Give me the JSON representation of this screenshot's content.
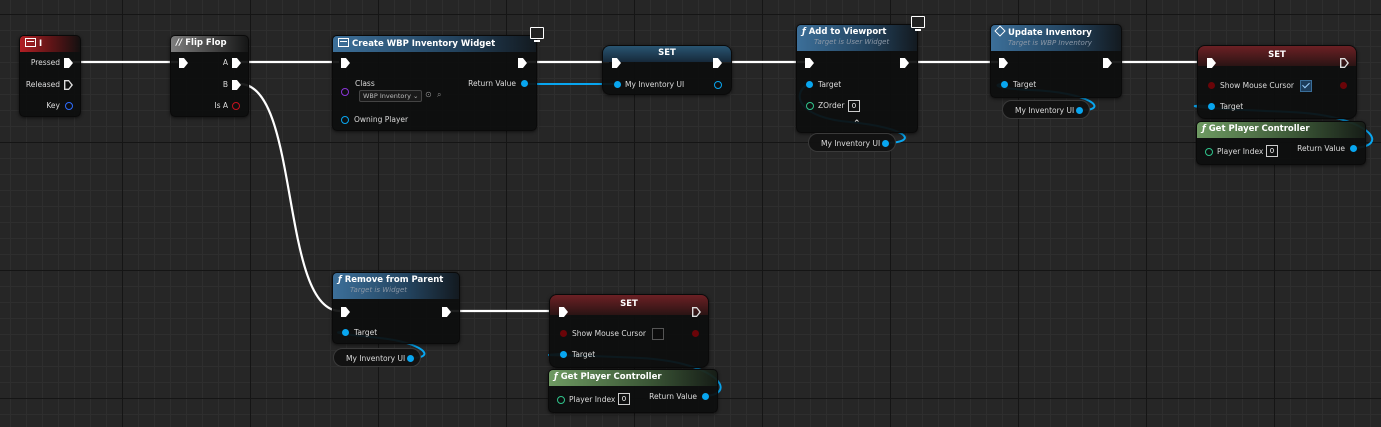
{
  "nodes": {
    "input_i": {
      "title": "I",
      "pressed": "Pressed",
      "released": "Released",
      "key": "Key"
    },
    "flipflop": {
      "title": "Flip Flop",
      "a": "A",
      "b": "B",
      "is_a": "Is A"
    },
    "create_widget": {
      "title": "Create WBP Inventory Widget",
      "class_label": "Class",
      "class_value": "WBP Inventory",
      "owning_player": "Owning Player",
      "return_value": "Return Value"
    },
    "set_inventory": {
      "title": "SET",
      "var": "My Inventory UI"
    },
    "add_viewport": {
      "title": "Add to Viewport",
      "subtitle": "Target is User Widget",
      "target": "Target",
      "zorder": "ZOrder",
      "zorder_value": "0"
    },
    "update_inventory": {
      "title": "Update Inventory",
      "subtitle": "Target is WBP Inventory",
      "target": "Target"
    },
    "set_cursor_true": {
      "title": "SET",
      "show_cursor": "Show Mouse Cursor",
      "target": "Target"
    },
    "get_pc_1": {
      "title": "Get Player Controller",
      "player_index": "Player Index",
      "index_value": "0",
      "return_value": "Return Value"
    },
    "remove_parent": {
      "title": "Remove from Parent",
      "subtitle": "Target is Widget",
      "target": "Target"
    },
    "set_cursor_false": {
      "title": "SET",
      "show_cursor": "Show Mouse Cursor",
      "target": "Target"
    },
    "get_pc_2": {
      "title": "Get Player Controller",
      "player_index": "Player Index",
      "index_value": "0",
      "return_value": "Return Value"
    }
  },
  "getters": {
    "viewport_var": "My Inventory UI",
    "update_var": "My Inventory UI",
    "remove_var": "My Inventory UI"
  },
  "colors": {
    "exec_wire": "#ffffff",
    "object_pin": "#08a6f0",
    "bool_pin": "#c4121e",
    "class_pin": "#8a34d6",
    "int_pin": "#30c48c"
  }
}
